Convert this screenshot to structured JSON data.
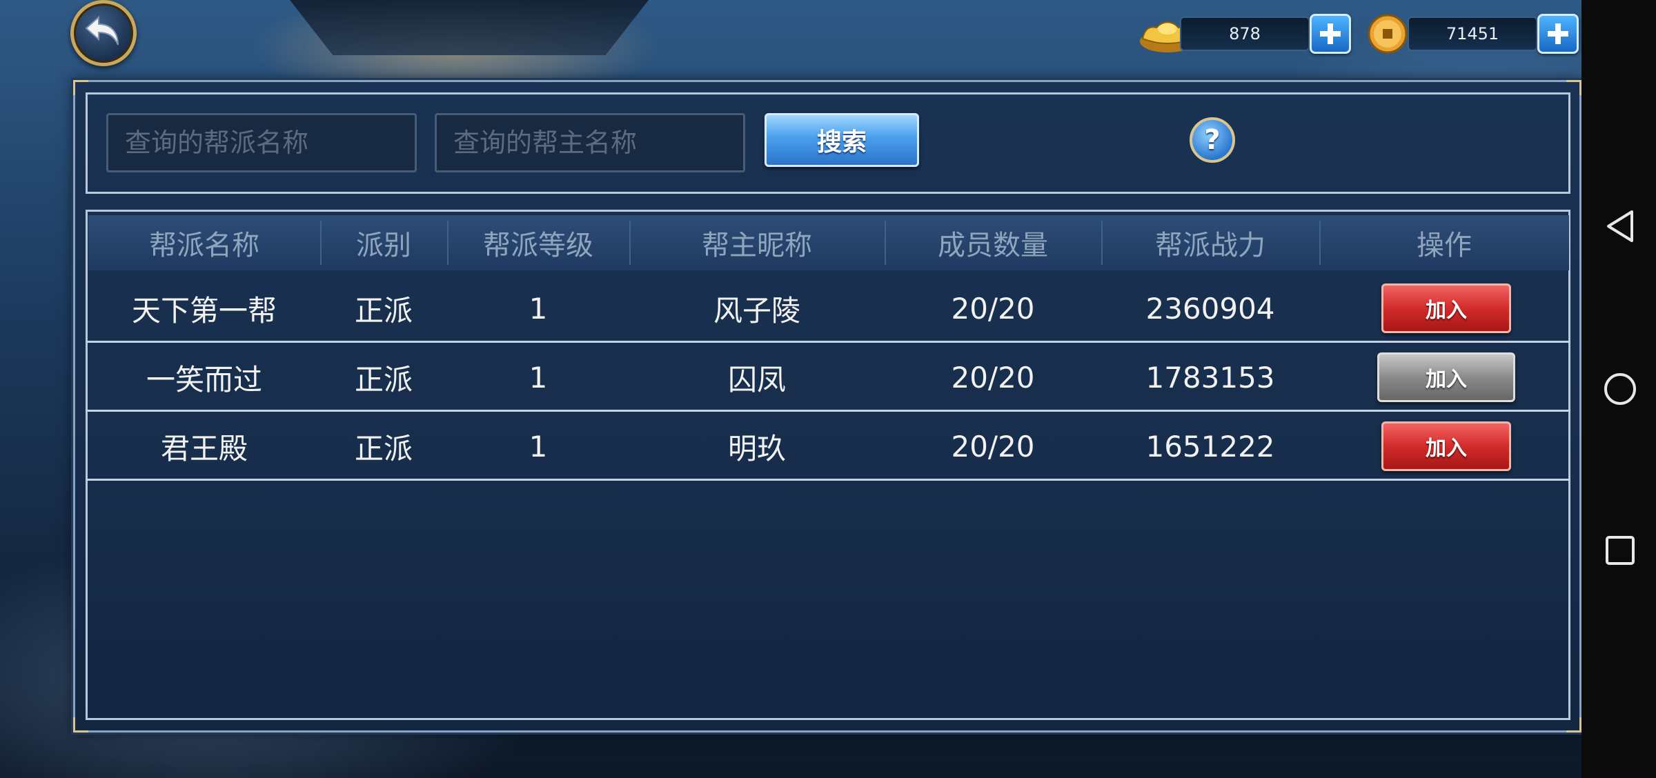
{
  "currency": {
    "gold": {
      "icon": "gold-ingot-icon",
      "value": "878"
    },
    "copper": {
      "icon": "coin-icon",
      "value": "71451"
    }
  },
  "search": {
    "guild_name_placeholder": "查询的帮派名称",
    "leader_name_placeholder": "查询的帮主名称",
    "button_label": "搜索",
    "help_label": "?"
  },
  "table": {
    "headers": [
      "帮派名称",
      "派别",
      "帮派等级",
      "帮主昵称",
      "成员数量",
      "帮派战力",
      "操作"
    ],
    "rows": [
      {
        "name": "天下第一帮",
        "faction": "正派",
        "level": "1",
        "leader": "风子陵",
        "members": "20/20",
        "power": "2360904",
        "action": "加入",
        "action_state": "enabled"
      },
      {
        "name": "一笑而过",
        "faction": "正派",
        "level": "1",
        "leader": "囚凤",
        "members": "20/20",
        "power": "1783153",
        "action": "加入",
        "action_state": "disabled"
      },
      {
        "name": "君王殿",
        "faction": "正派",
        "level": "1",
        "leader": "明玖",
        "members": "20/20",
        "power": "1651222",
        "action": "加入",
        "action_state": "enabled"
      }
    ]
  },
  "colors": {
    "join_enabled": "#d22b2b",
    "join_disabled": "#8b8b8b",
    "accent_blue": "#2b74c9"
  }
}
